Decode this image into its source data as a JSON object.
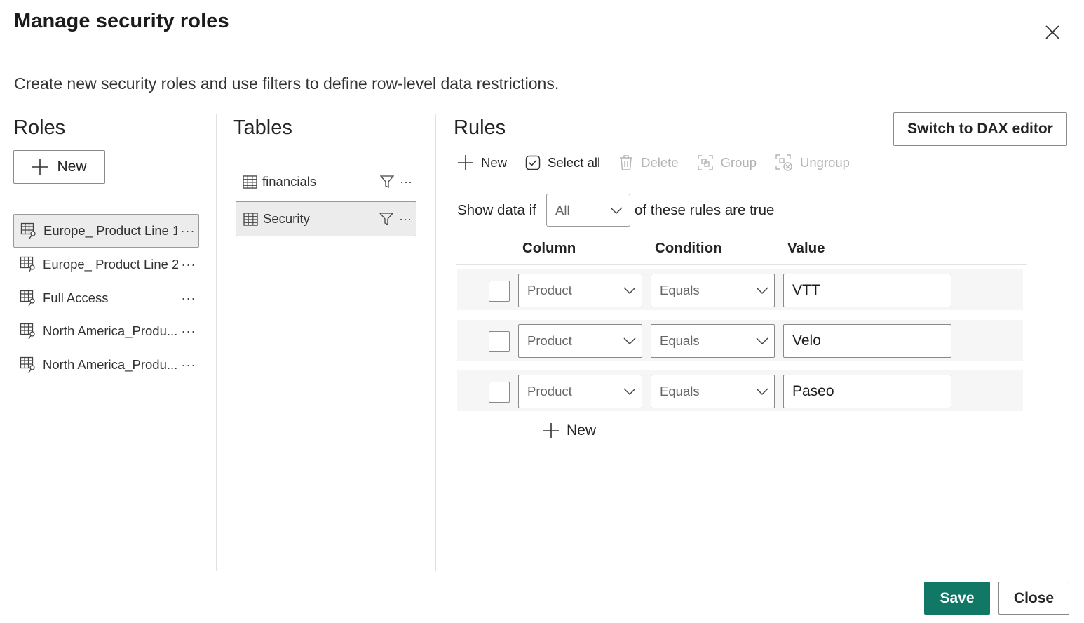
{
  "dialog": {
    "title": "Manage security roles",
    "subtitle": "Create new security roles and use filters to define row-level data restrictions."
  },
  "roles": {
    "heading": "Roles",
    "new_label": "New",
    "items": [
      {
        "label": "Europe_ Product Line 1",
        "selected": true
      },
      {
        "label": "Europe_ Product Line 2",
        "selected": false
      },
      {
        "label": "Full Access",
        "selected": false
      },
      {
        "label": "North America_Produ...",
        "selected": false
      },
      {
        "label": "North America_Produ...",
        "selected": false
      }
    ],
    "more_label": "···"
  },
  "tables": {
    "heading": "Tables",
    "items": [
      {
        "label": "financials",
        "selected": false
      },
      {
        "label": "Security",
        "selected": true
      }
    ],
    "more_label": "···"
  },
  "rules": {
    "heading": "Rules",
    "dax_button": "Switch to DAX editor",
    "toolbar": {
      "new": "New",
      "select_all": "Select all",
      "delete": "Delete",
      "group": "Group",
      "ungroup": "Ungroup"
    },
    "show_data_if": "Show data if",
    "match_mode": "All",
    "rules_true": "of these rules are true",
    "columns": {
      "column": "Column",
      "condition": "Condition",
      "value": "Value"
    },
    "rows": [
      {
        "column": "Product",
        "condition": "Equals",
        "value": "VTT"
      },
      {
        "column": "Product",
        "condition": "Equals",
        "value": "Velo"
      },
      {
        "column": "Product",
        "condition": "Equals",
        "value": "Paseo"
      }
    ],
    "new_rule": "New"
  },
  "footer": {
    "save": "Save",
    "close": "Close"
  },
  "colors": {
    "primary": "#117865",
    "selected_bg": "#ececec",
    "row_bg": "#f6f6f6"
  }
}
